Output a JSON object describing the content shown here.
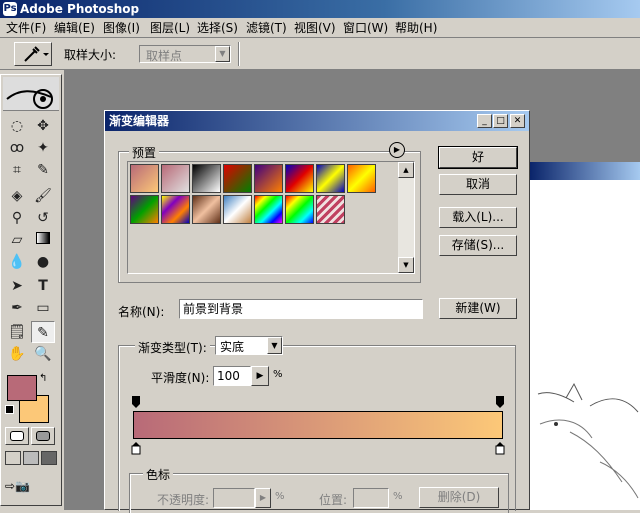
{
  "app": {
    "title": "Adobe Photoshop"
  },
  "menu": [
    "文件(F)",
    "编辑(E)",
    "图像(I)",
    "图层(L)",
    "选择(S)",
    "滤镜(T)",
    "视图(V)",
    "窗口(W)",
    "帮助(H)"
  ],
  "options_bar": {
    "sample_size_label": "取样大小:",
    "sample_size_value": "取样点"
  },
  "toolbox": {
    "icons": [
      "marquee-icon",
      "move-icon",
      "lasso-icon",
      "magic-wand-icon",
      "crop-icon",
      "slice-icon",
      "healing-brush-icon",
      "brush-icon",
      "clone-stamp-icon",
      "history-brush-icon",
      "eraser-icon",
      "gradient-icon",
      "blur-icon",
      "dodge-icon",
      "path-select-icon",
      "type-icon",
      "pen-icon",
      "shape-icon",
      "notes-icon",
      "eyedropper-icon",
      "hand-icon",
      "zoom-icon"
    ],
    "foreground_color": "#b86a78",
    "background_color": "#fcc878"
  },
  "dialog": {
    "title": "渐变编辑器",
    "presets_label": "预置",
    "ok": "好",
    "cancel": "取消",
    "load": "载入(L)...",
    "save": "存储(S)...",
    "name_label": "名称(N):",
    "name_value": "前景到背景",
    "new_button": "新建(W)",
    "gradient_type_label": "渐变类型(T):",
    "gradient_type_value": "实底",
    "smoothness_label": "平滑度(N):",
    "smoothness_value": "100",
    "percent": "%",
    "color_stops_label": "色标",
    "opacity_label": "不透明度:",
    "location_label": "位置:",
    "delete_button": "删除(D)",
    "gradient_start": "#b86a78",
    "gradient_end": "#fcc878"
  },
  "presets": [
    {
      "name": "fg-to-bg",
      "css": "linear-gradient(135deg,#b86a78,#fcc878)"
    },
    {
      "name": "fg-to-transparent",
      "css": "linear-gradient(135deg,#b86a78,#e0e0e0)"
    },
    {
      "name": "black-white",
      "css": "linear-gradient(135deg,#000,#fff)"
    },
    {
      "name": "red-green",
      "css": "linear-gradient(135deg,#e00000,#008000)"
    },
    {
      "name": "violet-orange",
      "css": "linear-gradient(135deg,#400080,#ff8000)"
    },
    {
      "name": "blue-red-yellow",
      "css": "linear-gradient(135deg,#0000c0,#e00000,#ffff00)"
    },
    {
      "name": "blue-yellow-blue",
      "css": "linear-gradient(135deg,#0000c0,#ffff00,#0000c0)"
    },
    {
      "name": "orange-yellow-orange",
      "css": "linear-gradient(135deg,#ff6000,#ffff00,#ff6000)"
    },
    {
      "name": "violet-green-orange",
      "css": "linear-gradient(135deg,#600080,#00a000,#ff8000)"
    },
    {
      "name": "yellow-violet-orange-blue",
      "css": "linear-gradient(135deg,#ffff00,#8000c0,#ff8000,#0000c0)"
    },
    {
      "name": "copper",
      "css": "linear-gradient(135deg,#603018,#f0c0a0,#603018)"
    },
    {
      "name": "chrome",
      "css": "linear-gradient(135deg,#4080c0,#fff,#c08040)"
    },
    {
      "name": "spectrum",
      "css": "linear-gradient(135deg,#f00,#ff0,#0f0,#0ff,#00f,#f0f)"
    },
    {
      "name": "transparent-rainbow",
      "css": "linear-gradient(135deg,#f00,#ff0,#0f0,#0ff,#00f)"
    },
    {
      "name": "transparent-stripes",
      "css": "repeating-linear-gradient(135deg,#c04060 0 3px,#f0e0e0 3px 6px)"
    }
  ]
}
